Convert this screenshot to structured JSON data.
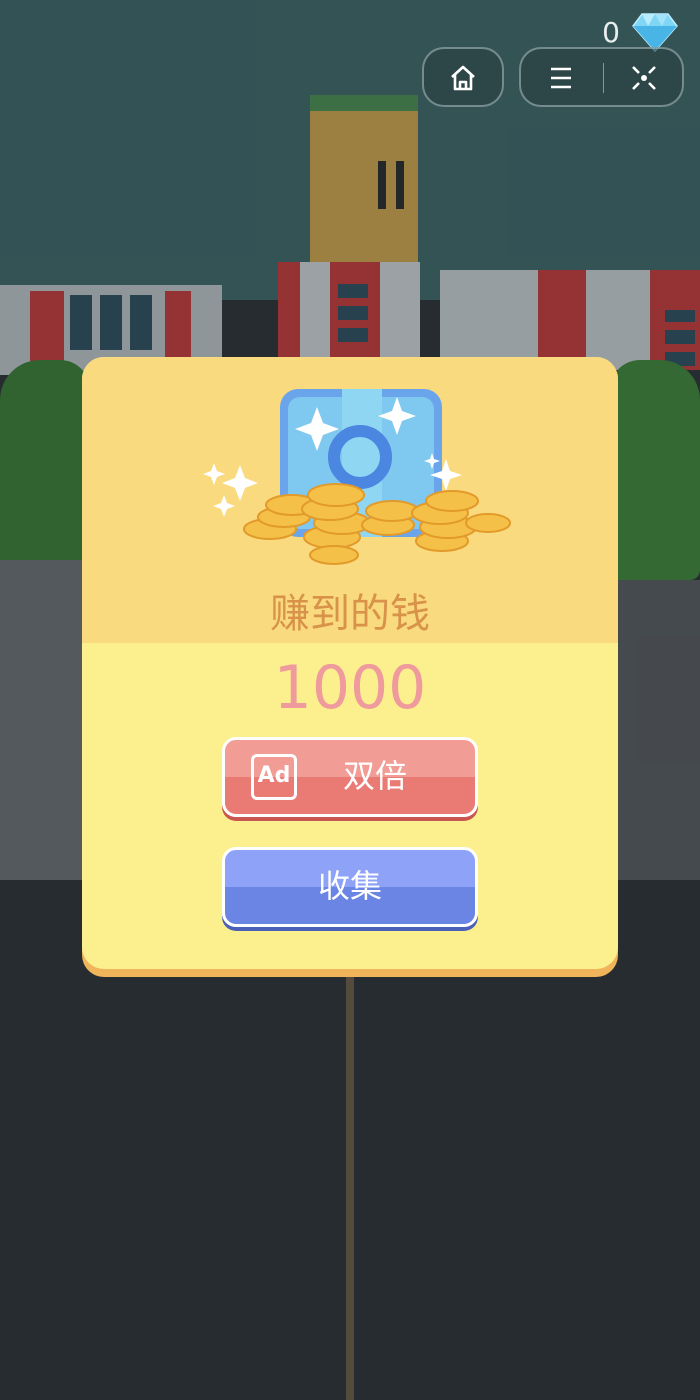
{
  "hud": {
    "gem_count": "0",
    "gem_icon": "diamond-icon",
    "home_icon": "home-icon",
    "menu_icon": "menu-icon",
    "close_icon": "close-icon"
  },
  "reward_dialog": {
    "title": "赚到的钱",
    "amount": "1000",
    "reward_icon": "coin-treasure-icon",
    "double_button": {
      "badge": "Ad",
      "label": "双倍"
    },
    "collect_button": {
      "label": "收集"
    }
  },
  "colors": {
    "dialog_bg": "#fcef8e",
    "dialog_header": "#f9da7e",
    "title": "#d8924a",
    "amount": "#ef9a9c",
    "double_button": "#ea7a74",
    "collect_button": "#6a85e3"
  }
}
